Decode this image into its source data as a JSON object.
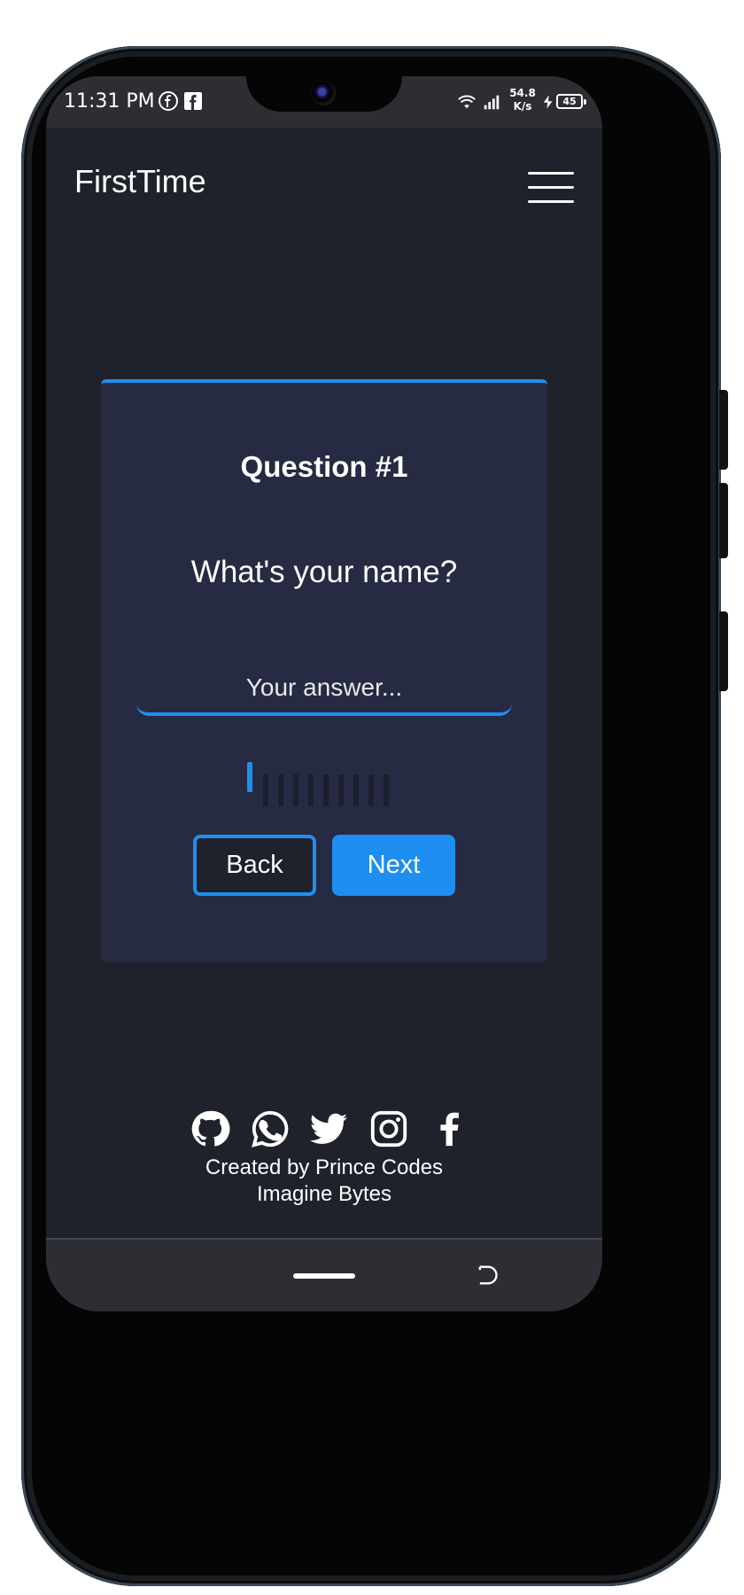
{
  "status_bar": {
    "time": "11:31 PM",
    "net_speed_value": "54.8",
    "net_speed_unit": "K/s",
    "battery": "45",
    "icons": [
      "facebook-messenger-icon",
      "facebook-icon",
      "wifi-icon",
      "signal-icon",
      "charging-icon",
      "battery-icon"
    ]
  },
  "header": {
    "brand": "FirstTime",
    "menu_icon": "hamburger-menu-icon"
  },
  "quiz": {
    "title": "Question #1",
    "question": "What's your name?",
    "answer_placeholder": "Your answer...",
    "answer_value": "",
    "progress_current": 1,
    "progress_total": 10,
    "back_label": "Back",
    "next_label": "Next"
  },
  "footer": {
    "social_icons": [
      "github-icon",
      "whatsapp-icon",
      "twitter-icon",
      "instagram-icon",
      "facebook-icon"
    ],
    "credit_line1": "Created by Prince Codes",
    "credit_line2": "Imagine Bytes"
  },
  "colors": {
    "accent": "#1e8ff0",
    "background": "#1f212b",
    "card": "#262a42",
    "system_bar": "#2c2e33"
  }
}
